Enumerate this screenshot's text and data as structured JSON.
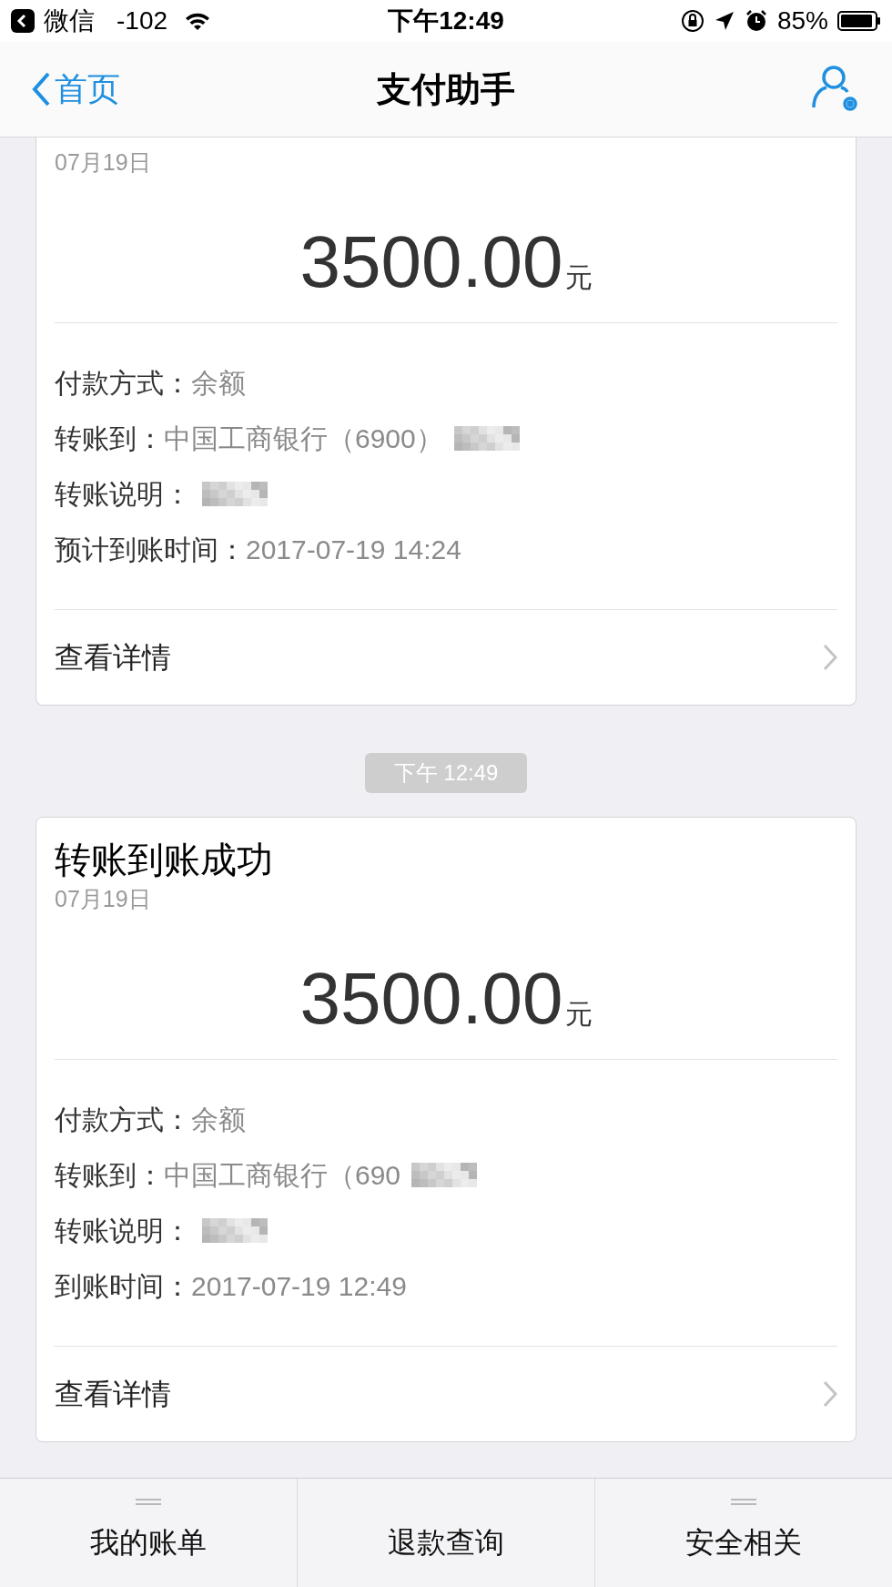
{
  "status_bar": {
    "back_app": "微信",
    "signal": "-102",
    "time": "下午12:49",
    "battery": "85%"
  },
  "nav": {
    "back": "首页",
    "title": "支付助手"
  },
  "cards": [
    {
      "date": "07月19日",
      "amount": "3500.00",
      "unit": "元",
      "rows": [
        {
          "label": "付款方式：",
          "value": "余额",
          "redacted": false
        },
        {
          "label": "转账到：",
          "value": "中国工商银行（6900）",
          "redacted": true
        },
        {
          "label": "转账说明：",
          "redacted": true
        },
        {
          "label": "预计到账时间：",
          "value": "2017-07-19 14:24",
          "redacted": false
        }
      ],
      "details": "查看详情"
    },
    {
      "time_pill": "下午 12:49",
      "title": "转账到账成功",
      "date": "07月19日",
      "amount": "3500.00",
      "unit": "元",
      "rows": [
        {
          "label": "付款方式：",
          "value": "余额",
          "redacted": false
        },
        {
          "label": "转账到：",
          "value": "中国工商银行（690",
          "redacted": true
        },
        {
          "label": "转账说明：",
          "redacted": true
        },
        {
          "label": "到账时间：",
          "value": "2017-07-19 12:49",
          "redacted": false
        }
      ],
      "details": "查看详情"
    }
  ],
  "tabs": [
    {
      "label": "我的账单",
      "has_menu": true
    },
    {
      "label": "退款查询",
      "has_menu": false
    },
    {
      "label": "安全相关",
      "has_menu": true
    }
  ]
}
